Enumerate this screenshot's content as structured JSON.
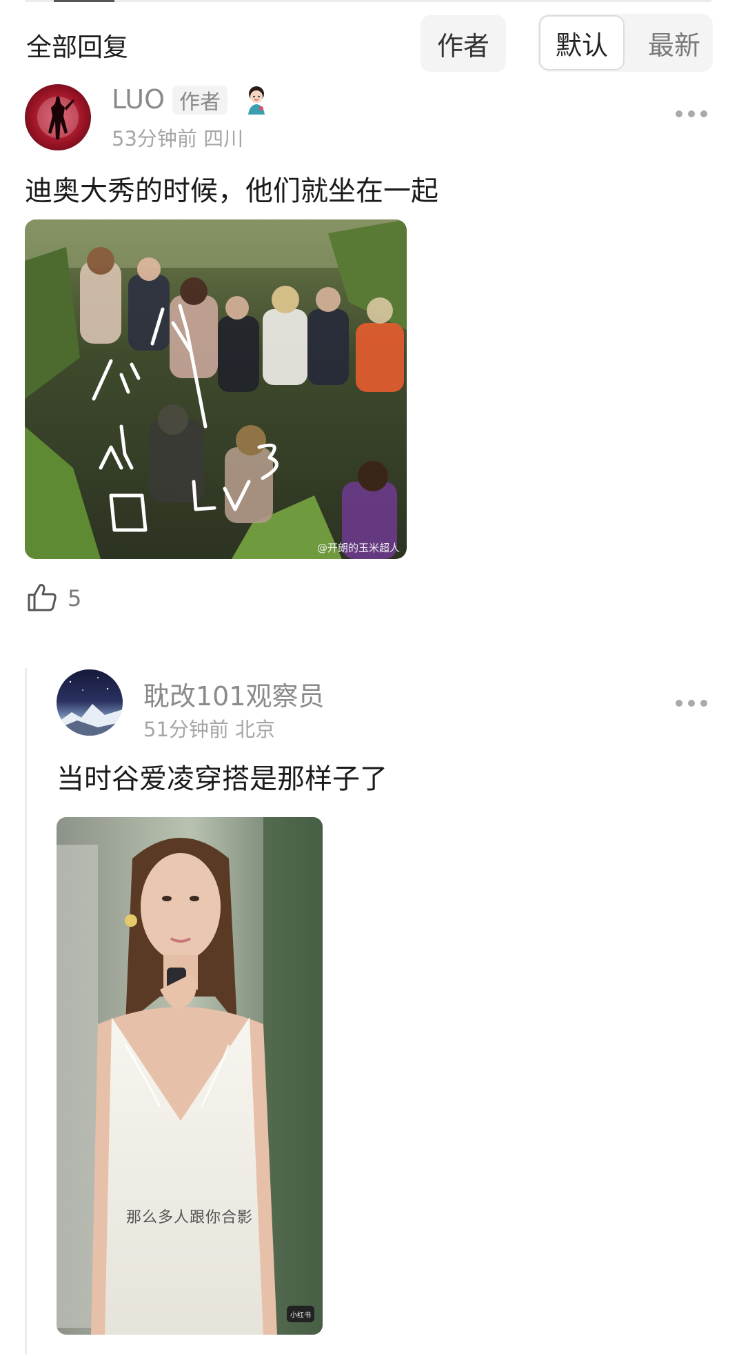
{
  "header": {
    "title": "全部回复",
    "filter_author": "作者",
    "sort_default": "默认",
    "sort_newest": "最新"
  },
  "comment": {
    "username": "LUO",
    "author_tag": "作者",
    "time": "53分钟前",
    "location": "四川",
    "text": "迪奥大秀的时候，他们就坐在一起",
    "image": {
      "handwriting_top": "小小",
      "handwriting_bottom": "谷 LV3",
      "watermark": "@开朗的玉米超人"
    },
    "like_count": "5"
  },
  "reply": {
    "username": "耽改101观察员",
    "time": "51分钟前",
    "location": "北京",
    "text": "当时谷爱凌穿搭是那样子了",
    "image": {
      "caption": "那么多人跟你合影",
      "logo_text": "小红书"
    }
  },
  "icons": {
    "like": "thumbs-up-icon",
    "more": "more-dots-icon",
    "badge": "character-badge-icon"
  },
  "colors": {
    "secondary_text": "#8a8a8a",
    "meta_text": "#a6a6a6",
    "pill_bg": "#f4f4f4"
  }
}
